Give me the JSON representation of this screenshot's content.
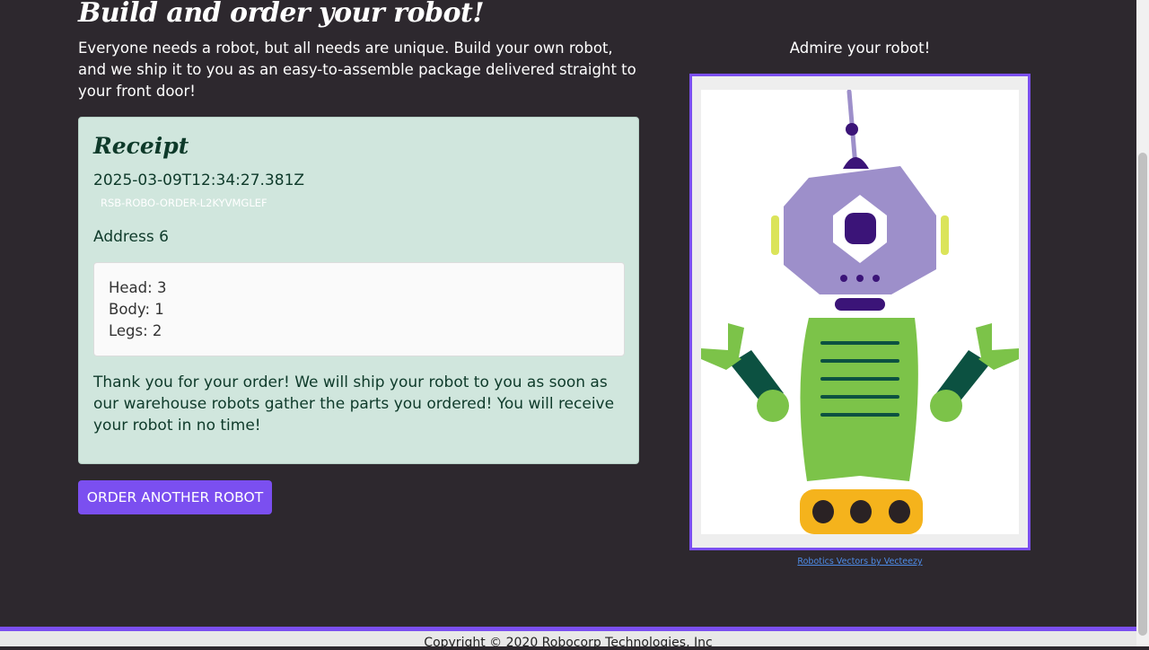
{
  "header": {
    "title": "Build and order your robot!",
    "intro": "Everyone needs a robot, but all needs are unique. Build your own robot, and we ship it to you as an easy-to-assemble package delivered straight to your front door!"
  },
  "receipt": {
    "heading": "Receipt",
    "timestamp": "2025-03-09T12:34:27.381Z",
    "order_id": "RSB-ROBO-ORDER-L2KYVMGLEF",
    "address": "Address 6",
    "parts": {
      "head": "Head: 3",
      "body": "Body: 1",
      "legs": "Legs: 2"
    },
    "thanks": "Thank you for your order! We will ship your robot to you as soon as our warehouse robots gather the parts you ordered! You will receive your robot in no time!"
  },
  "actions": {
    "order_another_label": "ORDER ANOTHER ROBOT"
  },
  "preview": {
    "heading": "Admire your robot!",
    "credit_link": "Robotics Vectors by Vecteezy"
  },
  "footer": {
    "copyright": "Copyright © 2020 Robocorp Technologies, Inc"
  },
  "colors": {
    "background": "#2d282e",
    "accent": "#7b4ff0",
    "receipt_bg": "#d0e6dd",
    "robot_purple": "#9d8fca",
    "robot_green": "#7cc349"
  }
}
